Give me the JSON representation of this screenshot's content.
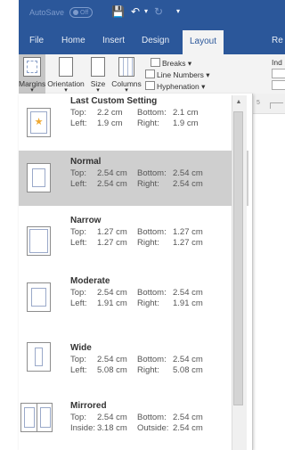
{
  "titlebar": {
    "autosave_label": "AutoSave",
    "autosave_state": "Off",
    "icons": [
      "save-icon",
      "undo-icon",
      "redo-icon",
      "qat-more-icon"
    ]
  },
  "tabs": [
    {
      "label": "File"
    },
    {
      "label": "Home"
    },
    {
      "label": "Insert"
    },
    {
      "label": "Design"
    },
    {
      "label": "Layout",
      "active": true
    },
    {
      "label": "Re"
    }
  ],
  "ribbon": {
    "margins": "Margins",
    "orientation": "Orientation",
    "size": "Size",
    "columns": "Columns",
    "breaks": "Breaks",
    "line_numbers": "Line Numbers",
    "hyphenation": "Hyphenation",
    "indent_fragment": "Ind"
  },
  "ruler": {
    "number": "5"
  },
  "margin_options": [
    {
      "title": "Last Custom Setting",
      "row1": {
        "k1": "Top:",
        "v1": "2.2 cm",
        "k2": "Bottom:",
        "v2": "2.1 cm"
      },
      "row2": {
        "k1": "Left:",
        "v1": "1.9 cm",
        "k2": "Right:",
        "v2": "1.9 cm"
      },
      "icon": "star-icon"
    },
    {
      "title": "Normal",
      "selected": true,
      "row1": {
        "k1": "Top:",
        "v1": "2.54 cm",
        "k2": "Bottom:",
        "v2": "2.54 cm"
      },
      "row2": {
        "k1": "Left:",
        "v1": "2.54 cm",
        "k2": "Right:",
        "v2": "2.54 cm"
      }
    },
    {
      "title": "Narrow",
      "row1": {
        "k1": "Top:",
        "v1": "1.27 cm",
        "k2": "Bottom:",
        "v2": "1.27 cm"
      },
      "row2": {
        "k1": "Left:",
        "v1": "1.27 cm",
        "k2": "Right:",
        "v2": "1.27 cm"
      }
    },
    {
      "title": "Moderate",
      "row1": {
        "k1": "Top:",
        "v1": "2.54 cm",
        "k2": "Bottom:",
        "v2": "2.54 cm"
      },
      "row2": {
        "k1": "Left:",
        "v1": "1.91 cm",
        "k2": "Right:",
        "v2": "1.91 cm"
      }
    },
    {
      "title": "Wide",
      "row1": {
        "k1": "Top:",
        "v1": "2.54 cm",
        "k2": "Bottom:",
        "v2": "2.54 cm"
      },
      "row2": {
        "k1": "Left:",
        "v1": "5.08 cm",
        "k2": "Right:",
        "v2": "5.08 cm"
      }
    },
    {
      "title": "Mirrored",
      "row1": {
        "k1": "Top:",
        "v1": "2.54 cm",
        "k2": "Bottom:",
        "v2": "2.54 cm"
      },
      "row2": {
        "k1": "Inside:",
        "v1": "3.18 cm",
        "k2": "Outside:",
        "v2": "2.54 cm"
      }
    }
  ],
  "colors": {
    "brand": "#2b579a",
    "selected": "#cfcfcf",
    "star": "#f0a830"
  }
}
